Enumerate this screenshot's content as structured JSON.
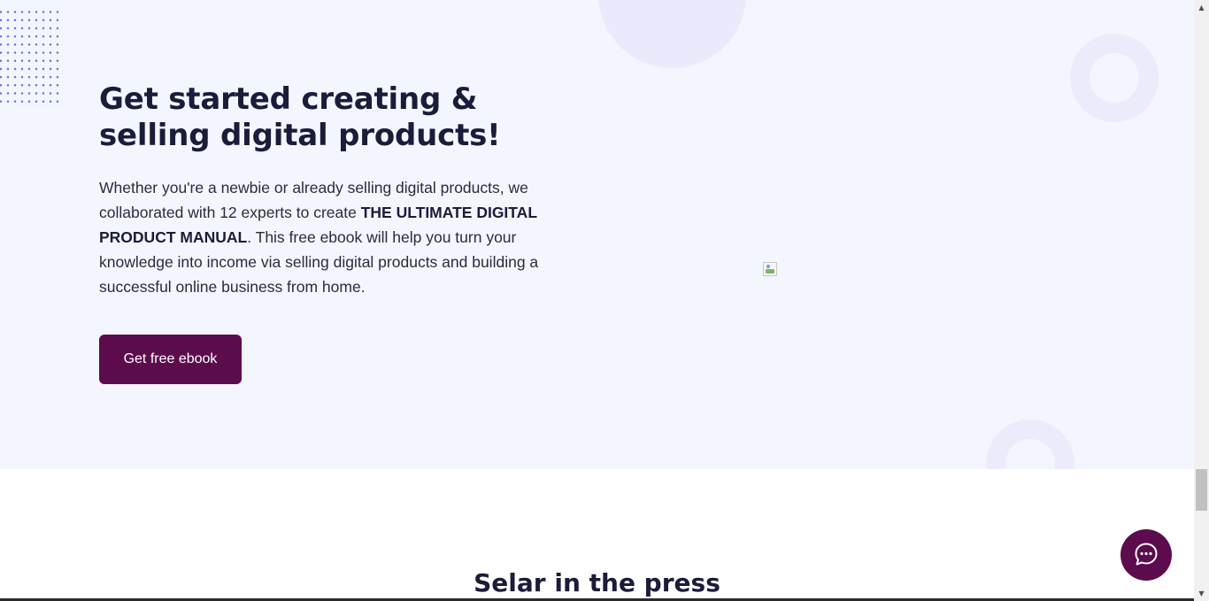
{
  "hero": {
    "title": "Get started creating & selling digital products!",
    "text_part1": "Whether you're a newbie or already selling digital products, we collaborated with 12 experts to create ",
    "text_bold": "THE ULTIMATE DIGITAL PRODUCT MANUAL",
    "text_part2": ". This free ebook will help you turn your knowledge into income via selling digital products and building a successful online business from home.",
    "cta_label": "Get free ebook"
  },
  "press": {
    "title": "Selar in the press"
  },
  "colors": {
    "hero_background": "#f3f5ff",
    "brand_purple": "#5c0c4c",
    "heading_text": "#1b1b3a",
    "decoration": "#ebeafd",
    "dot_pattern": "#6b6fd6"
  },
  "icons": {
    "chat": "chat-bubble-icon",
    "broken_image": "broken-image-icon",
    "scroll_up": "scroll-up-arrow-icon",
    "scroll_down": "scroll-down-arrow-icon"
  }
}
